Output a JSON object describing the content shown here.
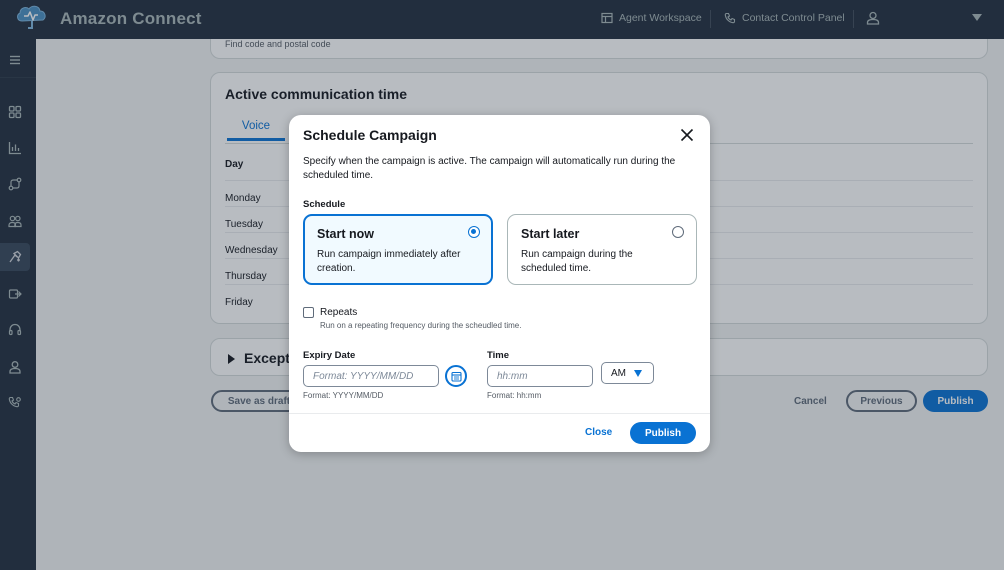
{
  "header": {
    "app_title": "Amazon Connect",
    "agent_workspace": "Agent Workspace",
    "contact_control_panel": "Contact Control Panel"
  },
  "background": {
    "fragment_text": "Find code and postal code",
    "section_title": "Active communication time",
    "tab_voice": "Voice",
    "day_header": "Day",
    "days": [
      "Monday",
      "Tuesday",
      "Wednesday",
      "Thursday",
      "Friday"
    ],
    "exceptions_title": "Excepti",
    "save_as_draft": "Save as draft",
    "cancel": "Cancel",
    "previous": "Previous",
    "publish": "Publish"
  },
  "modal": {
    "title": "Schedule Campaign",
    "description": "Specify when the campaign is active. The campaign will automatically run during the scheduled time.",
    "schedule_label": "Schedule",
    "options": [
      {
        "title": "Start now",
        "description": "Run campaign immediately after creation.",
        "selected": true
      },
      {
        "title": "Start later",
        "description": "Run campaign during the scheduled time.",
        "selected": false
      }
    ],
    "repeats": {
      "label": "Repeats",
      "description": "Run on a repeating frequency during the scheudled time.",
      "checked": false
    },
    "expiry_date": {
      "label": "Expiry Date",
      "placeholder": "Format: YYYY/MM/DD",
      "hint": "Format: YYYY/MM/DD"
    },
    "time": {
      "label": "Time",
      "placeholder": "hh:mm",
      "hint": "Format: hh:mm",
      "period": "AM"
    },
    "close_label": "Close",
    "publish_label": "Publish"
  }
}
